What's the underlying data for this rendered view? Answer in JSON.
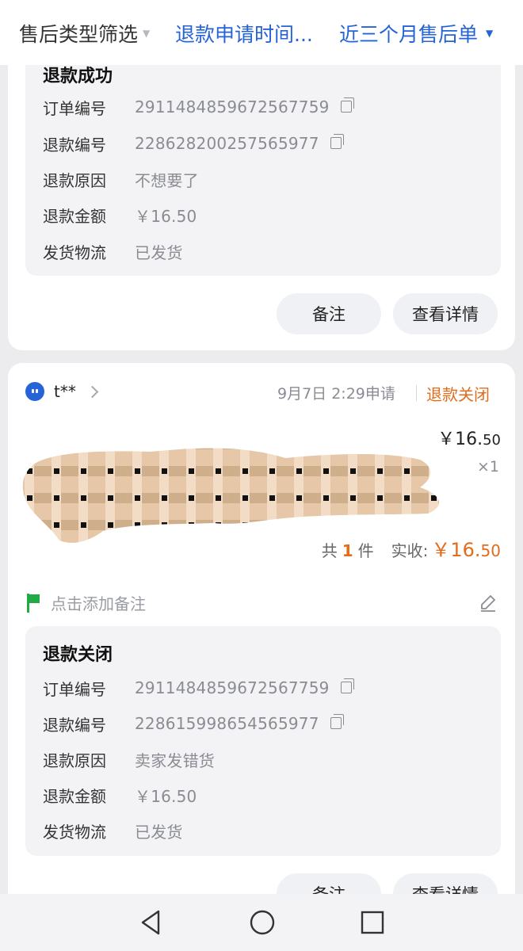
{
  "filters": [
    {
      "label": "售后类型筛选",
      "caret": "▼"
    },
    {
      "label": "退款申请时间...",
      "caret": ""
    },
    {
      "label": "近三个月售后单",
      "caret": "▼"
    }
  ],
  "orders": [
    {
      "status_title": "退款成功",
      "fields": [
        {
          "key": "订单编号",
          "value": "2911484859672567759",
          "copy": true
        },
        {
          "key": "退款编号",
          "value": "228628200257565977",
          "copy": true
        },
        {
          "key": "退款原因",
          "value": "不想要了"
        },
        {
          "key": "退款金额",
          "value": "￥16.50"
        },
        {
          "key": "发货物流",
          "value": "已发货"
        }
      ],
      "buttons": {
        "remark": "备注",
        "details": "查看详情"
      }
    },
    {
      "store": "t**",
      "apply_time": "9月7日 2:29申请",
      "status": "退款关闭",
      "item_price": "￥16.",
      "item_price_cents": "50",
      "qty": "×1",
      "summary": {
        "prefix": "共",
        "count": "1",
        "suffix": "件",
        "paid_label": "实收:",
        "paid": "￥16.",
        "paid_cents": "50"
      },
      "remark_placeholder": "点击添加备注",
      "status_title": "退款关闭",
      "fields": [
        {
          "key": "订单编号",
          "value": "2911484859672567759",
          "copy": true
        },
        {
          "key": "退款编号",
          "value": "228615998654565977",
          "copy": true
        },
        {
          "key": "退款原因",
          "value": "卖家发错货"
        },
        {
          "key": "退款金额",
          "value": "￥16.50"
        },
        {
          "key": "发货物流",
          "value": "已发货"
        }
      ],
      "buttons": {
        "remark": "备注",
        "details": "查看详情"
      }
    }
  ],
  "colors": {
    "accent": "#2563d6",
    "status": "#e36c1b",
    "flag": "#22aa44"
  },
  "icons": [
    "copy-icon",
    "store-icon",
    "chevron-right-icon",
    "flag-icon",
    "edit-icon",
    "nav-back-icon",
    "nav-home-icon",
    "nav-recents-icon"
  ]
}
